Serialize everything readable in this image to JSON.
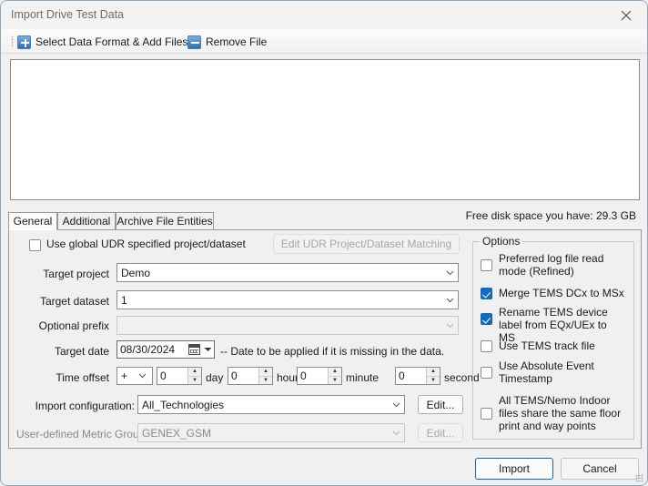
{
  "window": {
    "title": "Import Drive Test Data",
    "close_icon": "close-icon"
  },
  "toolbar": {
    "items": [
      {
        "label": "Select Data Format & Add Files...",
        "icon": "add-plus-icon"
      },
      {
        "label": "Remove File",
        "icon": "remove-minus-icon"
      }
    ]
  },
  "file_list": {
    "items": []
  },
  "status": {
    "free_disk": "Free disk space you have: 29.3 GB"
  },
  "tabs": [
    {
      "label": "General",
      "active": true
    },
    {
      "label": "Additional",
      "active": false
    },
    {
      "label": "Archive File Entities",
      "active": false
    }
  ],
  "general": {
    "use_global_udr": {
      "label": "Use global UDR specified project/dataset",
      "checked": false
    },
    "edit_udr_button": "Edit UDR Project/Dataset Matching",
    "target_project": {
      "label": "Target project",
      "value": "Demo"
    },
    "target_dataset": {
      "label": "Target dataset",
      "value": "1"
    },
    "optional_prefix": {
      "label": "Optional prefix",
      "value": ""
    },
    "target_date": {
      "label": "Target date",
      "value": "08/30/2024",
      "hint": "-- Date to be applied if it is missing in the data."
    },
    "time_offset": {
      "label": "Time offset",
      "sign": "+",
      "day": "0",
      "day_unit": "day",
      "hour": "0",
      "hour_unit": "hour",
      "minute": "0",
      "minute_unit": "minute",
      "second": "0",
      "second_unit": "second"
    },
    "import_configuration": {
      "label": "Import configuration:",
      "value": "All_Technologies",
      "edit_label": "Edit..."
    },
    "user_defined_metric_group": {
      "label": "User-defined Metric Group:",
      "value": "GENEX_GSM",
      "edit_label": "Edit..."
    }
  },
  "options": {
    "title": "Options",
    "items": [
      {
        "label": "Preferred log file read mode (Refined)",
        "checked": false
      },
      {
        "label": "Merge TEMS DCx to MSx",
        "checked": true
      },
      {
        "label": "Rename TEMS device label from EQx/UEx to MS",
        "checked": true
      },
      {
        "label": "Use TEMS track file",
        "checked": false
      },
      {
        "label": "Use Absolute Event Timestamp",
        "checked": false
      },
      {
        "label": "All TEMS/Nemo Indoor files share the same floor print and way points",
        "checked": false
      }
    ]
  },
  "footer": {
    "import_label": "Import",
    "cancel_label": "Cancel"
  },
  "colors": {
    "accent": "#0f6cbd",
    "window_border": "#8aa8c0",
    "dialog_bg": "#f0f0f0"
  }
}
